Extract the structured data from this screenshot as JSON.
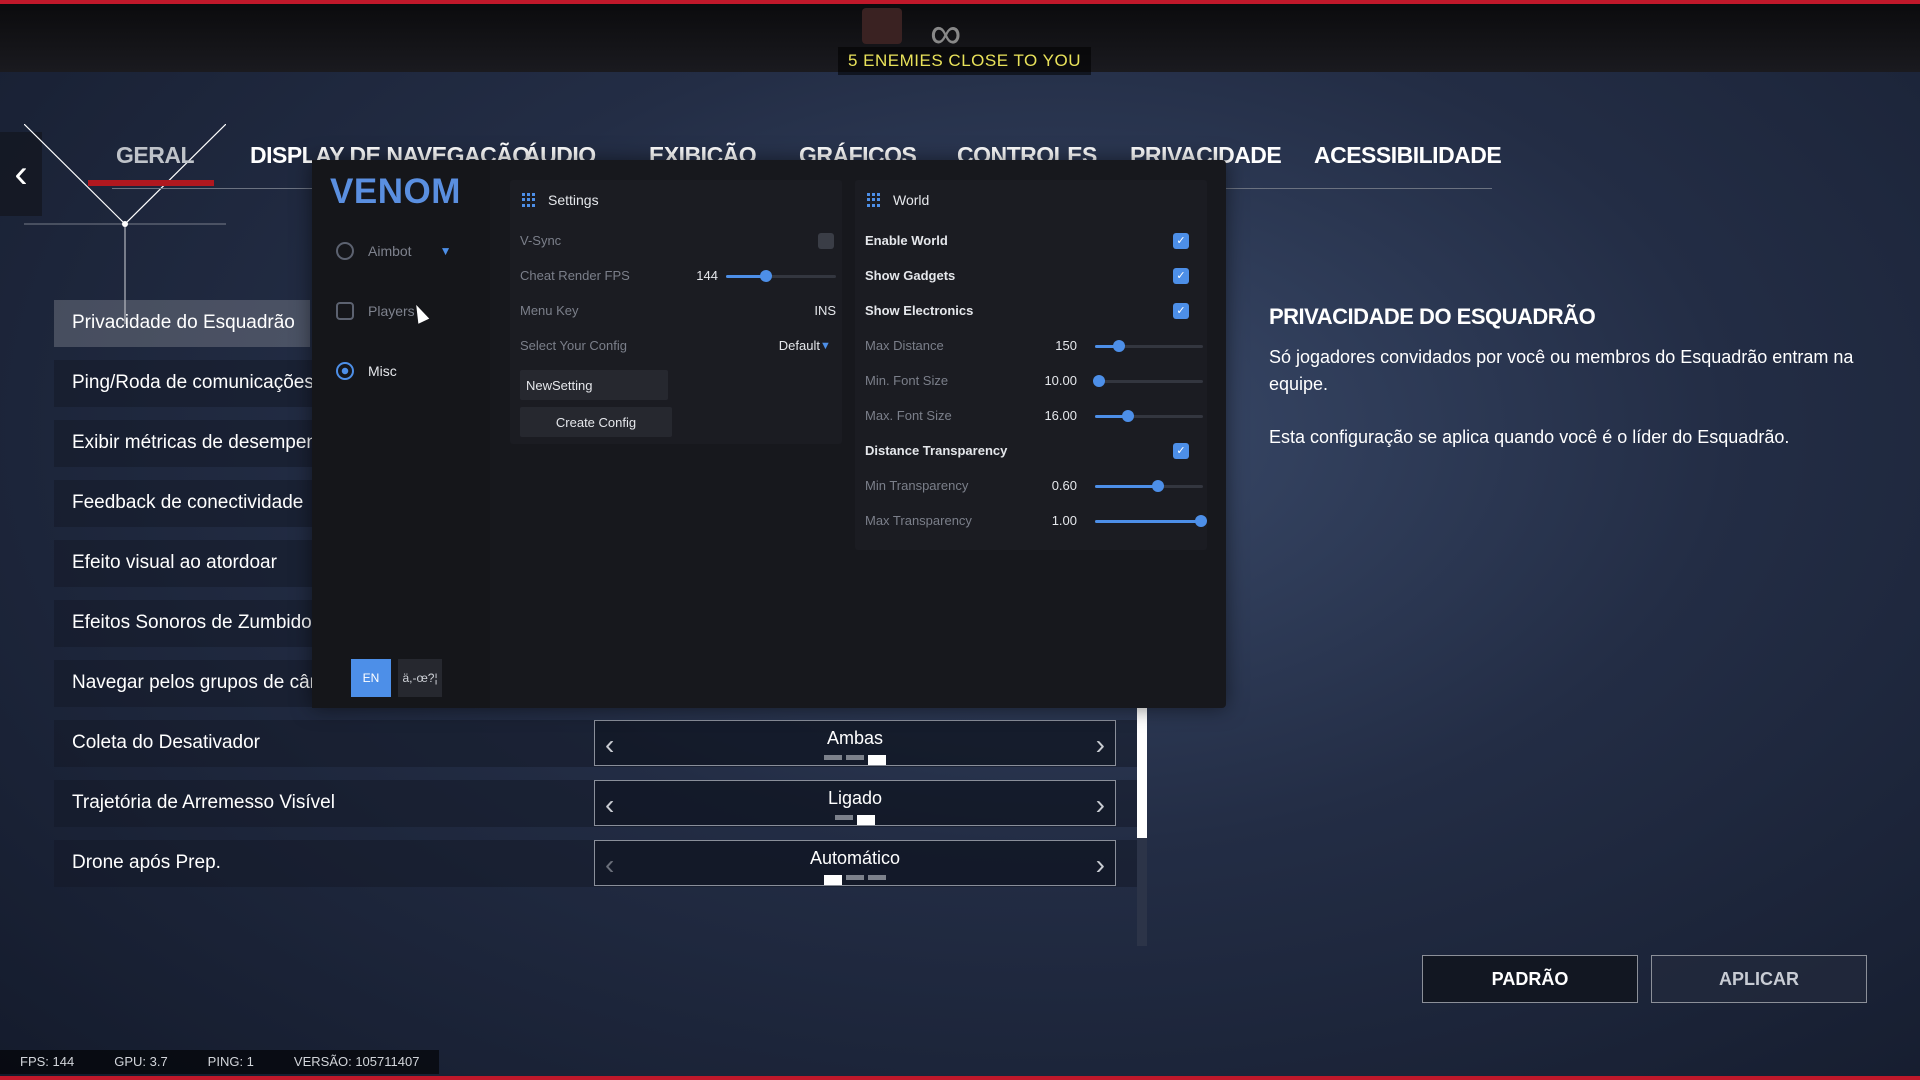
{
  "hud": {
    "alert": "5 ENEMIES CLOSE TO YOU",
    "infinity": "∞"
  },
  "tabs": [
    "GERAL",
    "DISPLAY DE NAVEGAÇÃO",
    "ÁUDIO",
    "EXIBIÇÃO",
    "GRÁFICOS",
    "CONTROLES",
    "PRIVACIDADE",
    "ACESSIBILIDADE"
  ],
  "list": [
    {
      "label": "Privacidade do Esquadrão"
    },
    {
      "label": "Ping/Roda de comunicações"
    },
    {
      "label": "Exibir métricas de desempenh"
    },
    {
      "label": "Feedback de conectividade"
    },
    {
      "label": "Efeito visual ao atordoar"
    },
    {
      "label": "Efeitos Sonoros de Zumbido"
    },
    {
      "label": "Navegar pelos grupos de câm"
    },
    {
      "label": "Coleta do Desativador",
      "value": "Ambas",
      "pips": [
        0,
        0,
        1
      ]
    },
    {
      "label": "Trajetória de Arremesso Visível",
      "value": "Ligado",
      "pips": [
        0,
        1
      ]
    },
    {
      "label": "Drone após Prep.",
      "value": "Automático",
      "pips": [
        1,
        0,
        0
      ]
    }
  ],
  "info": {
    "title": "PRIVACIDADE DO ESQUADRÃO",
    "p1": "Só jogadores convidados por você ou membros do Esquadrão entram na equipe.",
    "p2": "Esta configuração se aplica quando você é o líder do Esquadrão."
  },
  "buttons": {
    "default": "PADRÃO",
    "apply": "APLICAR"
  },
  "footer": {
    "fps": "FPS: 144",
    "gpu": "GPU: 3.7",
    "ping": "PING: 1",
    "version": "VERSÃO: 105711407"
  },
  "menu": {
    "logo": "VENOM",
    "nav": {
      "aimbot": "Aimbot",
      "players": "Players",
      "misc": "Misc"
    },
    "lang": {
      "en": "EN",
      "other": "ä,-œ?¦"
    },
    "settings": {
      "title": "Settings",
      "vsync": "V-Sync",
      "fps_label": "Cheat Render FPS",
      "fps_value": "144",
      "fps_fraction": 0.36,
      "menu_key_label": "Menu Key",
      "menu_key_value": "INS",
      "config_label": "Select Your Config",
      "config_value": "Default",
      "new_setting": "NewSetting",
      "create_config": "Create Config"
    },
    "world": {
      "title": "World",
      "enable_world": "Enable World",
      "show_gadgets": "Show Gadgets",
      "show_electronics": "Show Electronics",
      "max_distance_label": "Max Distance",
      "max_distance_value": "150",
      "max_distance_fraction": 0.22,
      "min_font_label": "Min. Font Size",
      "min_font_value": "10.00",
      "min_font_fraction": 0.04,
      "max_font_label": "Max. Font Size",
      "max_font_value": "16.00",
      "max_font_fraction": 0.31,
      "distance_transparency": "Distance Transparency",
      "min_transparency_label": "Min Transparency",
      "min_transparency_value": "0.60",
      "min_transparency_fraction": 0.58,
      "max_transparency_label": "Max Transparency",
      "max_transparency_value": "1.00",
      "max_transparency_fraction": 0.98
    }
  },
  "colors": {
    "accent": "#4d8fe8",
    "red": "#c0182a",
    "alert": "#e9e25a"
  }
}
